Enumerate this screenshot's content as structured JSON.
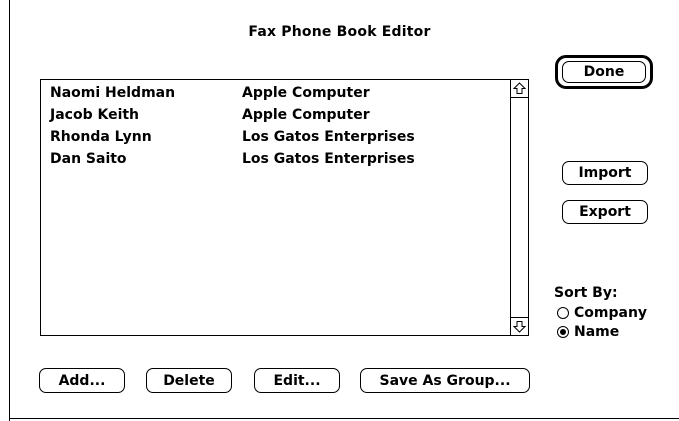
{
  "window": {
    "title": "Fax Phone Book Editor"
  },
  "entries": [
    {
      "name": "Naomi Heldman",
      "company": "Apple Computer"
    },
    {
      "name": "Jacob Keith",
      "company": "Apple Computer"
    },
    {
      "name": "Rhonda Lynn",
      "company": "Los Gatos Enterprises"
    },
    {
      "name": "Dan Saito",
      "company": "Los Gatos Enterprises"
    }
  ],
  "buttons": {
    "done": "Done",
    "import": "Import",
    "export": "Export",
    "add": "Add...",
    "delete": "Delete",
    "edit": "Edit...",
    "save_as_group": "Save As Group..."
  },
  "sort": {
    "label": "Sort By:",
    "options": [
      {
        "label": "Company",
        "selected": false
      },
      {
        "label": "Name",
        "selected": true
      }
    ]
  },
  "icons": {
    "scroll_up": "up-arrow-icon",
    "scroll_down": "down-arrow-icon"
  }
}
